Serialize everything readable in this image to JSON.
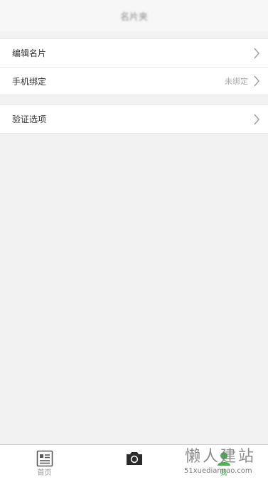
{
  "header": {
    "title": "名片夹"
  },
  "settings": {
    "group1": [
      {
        "label": "编辑名片",
        "value": ""
      },
      {
        "label": "手机绑定",
        "value": "未绑定"
      }
    ],
    "group2": [
      {
        "label": "验证选项",
        "value": ""
      }
    ]
  },
  "tabbar": {
    "tabs": [
      {
        "label": "首页",
        "icon": "card-icon",
        "active": false
      },
      {
        "label": "",
        "icon": "camera-icon",
        "active": false
      },
      {
        "label": "我",
        "icon": "person-icon",
        "active": true
      }
    ]
  },
  "watermark": {
    "title": "懒人建站",
    "url": "51xuediannao.com"
  },
  "colors": {
    "background": "#f2f2f2",
    "active_tab": "#4caf50",
    "chevron": "#a0a0a0"
  }
}
